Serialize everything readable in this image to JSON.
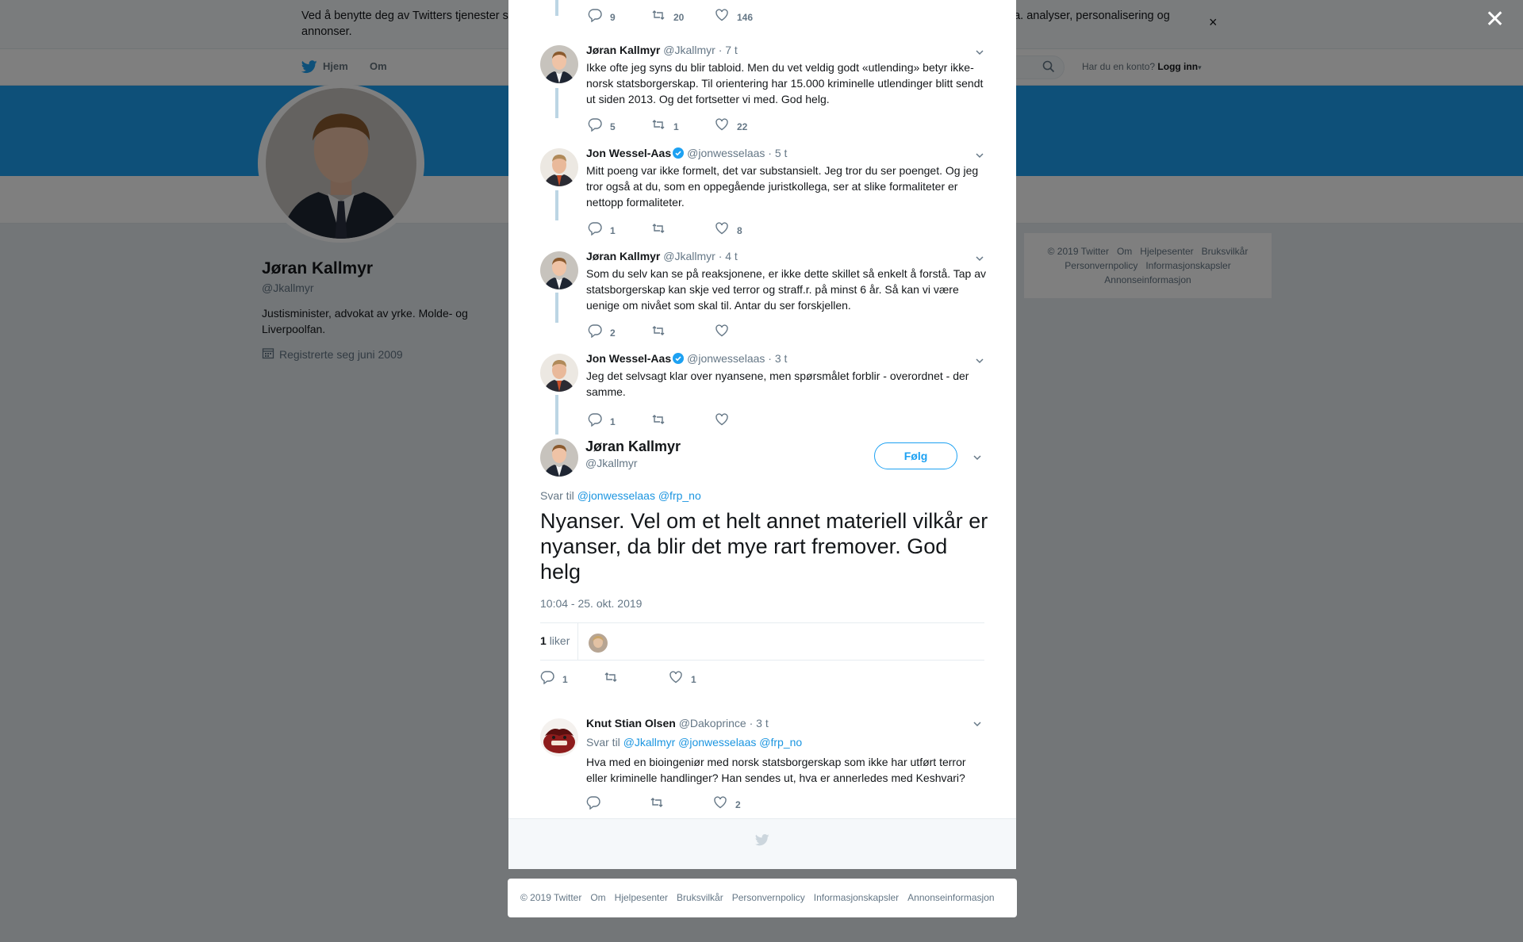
{
  "cookie_banner": {
    "text": "Ved å benytte deg av Twitters tjenester samtykker du i vår bruk av informasjonskapsler. Vi og våre partnere bruker informasjonskapsler til bl.a. analyser, personalisering og annonser.",
    "close": "×"
  },
  "topnav": {
    "home": "Hjem",
    "about": "Om",
    "login_prompt": "Har du en konto?",
    "login": "Logg inn"
  },
  "profile": {
    "name": "Jøran Kallmyr",
    "handle": "@Jkallmyr",
    "bio": "Justisminister, advokat av yrke. Molde- og Liverpoolfan.",
    "joined": "Registrerte seg juni 2009"
  },
  "side_footer": {
    "items": [
      "© 2019 Twitter",
      "Om",
      "Hjelpesenter",
      "Bruksvilkår",
      "Personvernpolicy",
      "Informasjonskapsler",
      "Annonseinformasjon"
    ]
  },
  "overlay_close": "✕",
  "thread": [
    {
      "name": "",
      "handle": "",
      "time": "",
      "text": "",
      "replies": "9",
      "retweets": "20",
      "likes": "146"
    },
    {
      "name": "Jøran Kallmyr",
      "handle": "@Jkallmyr",
      "time": "· 7 t",
      "text": "Ikke ofte jeg syns du blir tabloid. Men du vet veldig godt «utlending» betyr ikke-norsk statsborgerskap. Til orientering har 15.000 kriminelle utlendinger blitt sendt ut siden 2013. Og det fortsetter vi med. God helg.",
      "replies": "5",
      "retweets": "1",
      "likes": "22"
    },
    {
      "name": "Jon Wessel-Aas",
      "handle": "@jonwesselaas",
      "time": "· 5 t",
      "verified": true,
      "text": "Mitt poeng var ikke formelt, det var substansielt. Jeg tror du ser poenget. Og jeg tror også at du, som en oppegående juristkollega, ser at slike formaliteter er nettopp formaliteter.",
      "replies": "1",
      "retweets": "",
      "likes": "8"
    },
    {
      "name": "Jøran Kallmyr",
      "handle": "@Jkallmyr",
      "time": "· 4 t",
      "text": "Som du selv kan se på reaksjonene, er ikke dette skillet så enkelt å forstå. Tap av statsborgerskap kan skje ved terror og straff.r. på minst 6 år. Så kan vi være uenige om nivået som skal til. Antar du ser forskjellen.",
      "replies": "2",
      "retweets": "",
      "likes": ""
    },
    {
      "name": "Jon Wessel-Aas",
      "handle": "@jonwesselaas",
      "time": "· 3 t",
      "verified": true,
      "text": "Jeg det selvsagt klar over nyansene, men spørsmålet forblir - overordnet - der samme.",
      "replies": "1",
      "retweets": "",
      "likes": ""
    }
  ],
  "focused": {
    "name": "Jøran Kallmyr",
    "handle": "@Jkallmyr",
    "follow": "Følg",
    "reply_prefix": "Svar til",
    "reply_to": "@jonwesselaas @frp_no",
    "text": "Nyanser. Vel om et helt annet materiell vilkår er nyanser, da blir det mye rart fremover. God helg",
    "timestamp": "10:04 - 25. okt. 2019",
    "likes_count": "1",
    "likes_label": "liker",
    "replies": "1",
    "retweets": "",
    "likes": "1"
  },
  "reply": {
    "name": "Knut Stian Olsen",
    "handle": "@Dakoprince",
    "time": "· 3 t",
    "reply_prefix": "Svar til",
    "reply_to": "@Jkallmyr @jonwesselaas @frp_no",
    "text": "Hva med en bioingeniør med norsk statsborgerskap som ikke har utført terror eller kriminelle handlinger? Han sendes ut, hva er annerledes med Keshvari?",
    "replies": "",
    "retweets": "",
    "likes": "2"
  },
  "modal_footer": {
    "items": [
      "© 2019 Twitter",
      "Om",
      "Hjelpesenter",
      "Bruksvilkår",
      "Personvernpolicy",
      "Informasjonskapsler",
      "Annonseinformasjon"
    ]
  },
  "colors": {
    "accent": "#1da1f2",
    "link": "#1b95e0",
    "thread_line": "#bcd5e4",
    "overlay": "rgba(0,0,0,0.5)"
  }
}
